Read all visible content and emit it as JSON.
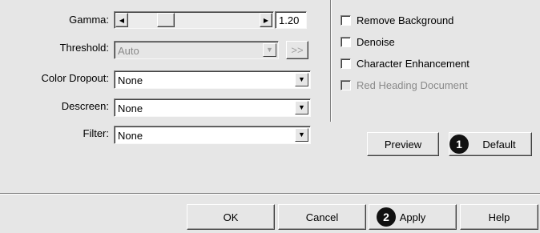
{
  "settings": {
    "gamma": {
      "label": "Gamma:",
      "value": "1.20",
      "slider_fraction": 0.25
    },
    "threshold": {
      "label": "Threshold:",
      "value": "Auto",
      "more_label": ">>"
    },
    "color_dropout": {
      "label": "Color Dropout:",
      "value": "None"
    },
    "descreen": {
      "label": "Descreen:",
      "value": "None"
    },
    "filter": {
      "label": "Filter:",
      "value": "None"
    }
  },
  "options": [
    {
      "label": "Remove Background",
      "checked": false,
      "enabled": true
    },
    {
      "label": "Denoise",
      "checked": false,
      "enabled": true
    },
    {
      "label": "Character Enhancement",
      "checked": false,
      "enabled": true
    },
    {
      "label": "Red Heading Document",
      "checked": false,
      "enabled": false
    }
  ],
  "buttons": {
    "preview": "Preview",
    "default": "Default",
    "ok": "OK",
    "cancel": "Cancel",
    "apply": "Apply",
    "help": "Help"
  },
  "callouts": {
    "default_badge": "1",
    "apply_badge": "2"
  },
  "icons": {
    "left_arrow": "◀",
    "right_arrow": "▶",
    "dropdown_arrow": "▼"
  }
}
